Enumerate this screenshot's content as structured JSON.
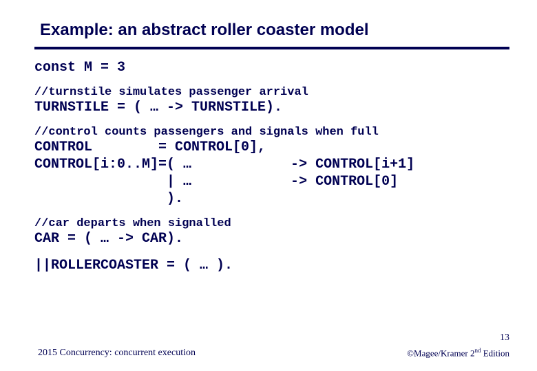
{
  "title": "Example: an abstract roller coaster model",
  "const_line": "const M = 3",
  "turnstile_comment": "//turnstile simulates passenger arrival",
  "turnstile_def": "TURNSTILE = ( … -> TURNSTILE).",
  "control_comment": "//control counts passengers and signals when full",
  "control_l1": "CONTROL        = CONTROL[0],",
  "control_l2": "CONTROL[i:0..M]=( …            -> CONTROL[i+1]",
  "control_l3": "                | …            -> CONTROL[0]",
  "control_l4": "                ).",
  "car_comment": "//car departs when signalled",
  "car_def": "CAR = ( … -> CAR).",
  "rc_def": "||ROLLERCOASTER = ( … ).",
  "pagenum": "13",
  "footer_left": "2015  Concurrency: concurrent execution",
  "footer_right_prefix": "©Magee/Kramer ",
  "footer_right_ed_num": "2",
  "footer_right_ed_sup": "nd",
  "footer_right_ed_suffix": " Edition"
}
